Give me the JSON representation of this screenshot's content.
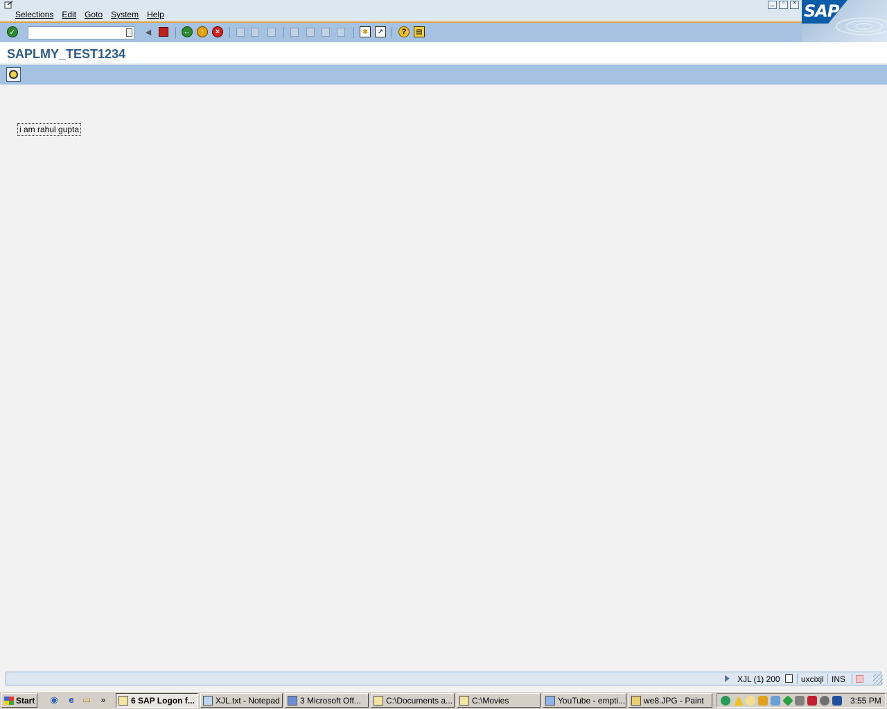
{
  "menu": {
    "items": [
      "Selections",
      "Edit",
      "Goto",
      "System",
      "Help"
    ]
  },
  "window_controls": [
    "minimize",
    "restore",
    "close"
  ],
  "logo": {
    "text": "SAP"
  },
  "toolbar": {
    "command_field_value": "",
    "icons": [
      "enter-icon",
      "back-nav-icon",
      "save-icon",
      "back-icon",
      "exit-icon",
      "cancel-icon",
      "print-icon",
      "find-icon",
      "find-next-icon",
      "first-page-icon",
      "previous-page-icon",
      "next-page-icon",
      "last-page-icon",
      "create-session-icon",
      "shortcut-icon",
      "help-icon",
      "layout-icon"
    ]
  },
  "screen": {
    "title": "SAPLMY_TEST1234"
  },
  "content": {
    "text": "i am rahul gupta"
  },
  "status": {
    "system": "XJL (1) 200",
    "server": "uxcixjl",
    "mode": "INS"
  },
  "taskbar": {
    "start_label": "Start",
    "tasks": [
      "6 SAP Logon f...",
      "XJL.txt - Notepad",
      "3 Microsoft Off...",
      "C:\\Documents a...",
      "C:\\Movies",
      "YouTube - empti...",
      "we8.JPG - Paint"
    ],
    "clock": "3:55 PM"
  },
  "colors": {
    "accent": "#a5c2e2",
    "title": "#2b5b88",
    "separator": "#e8a13a"
  }
}
